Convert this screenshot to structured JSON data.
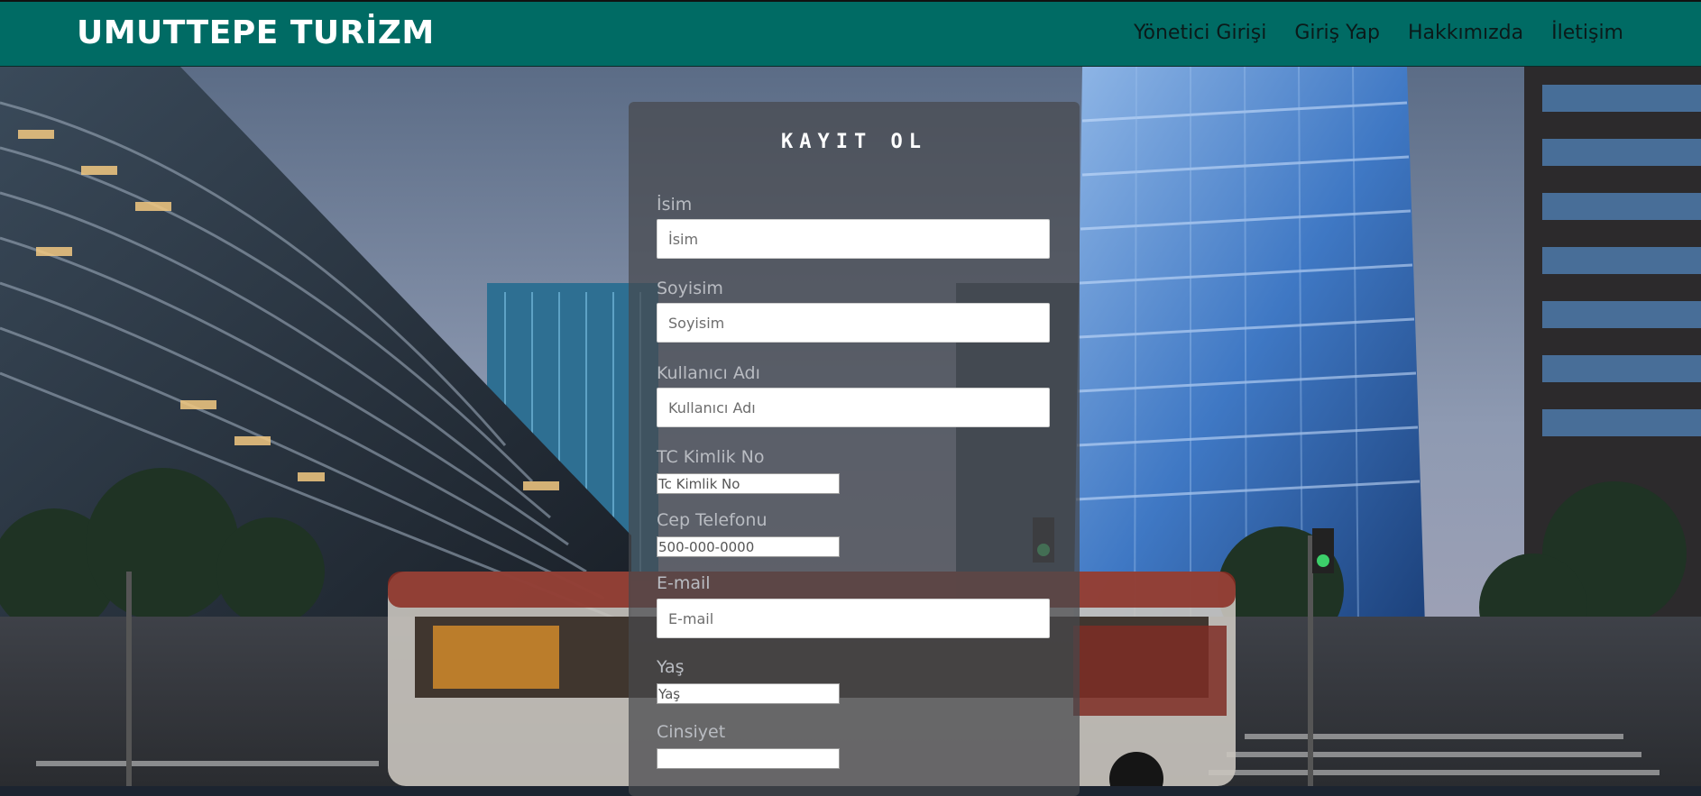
{
  "header": {
    "brand": "UMUTTEPE TURİZM",
    "nav": [
      "Yönetici Girişi",
      "Giriş Yap",
      "Hakkımızda",
      "İletişim"
    ]
  },
  "colors": {
    "header_bg": "#006b64",
    "card_bg": "rgba(70,72,76,0.72)",
    "label": "#b9bcc2"
  },
  "form": {
    "title": "KAYIT OL",
    "fields": [
      {
        "label": "İsim",
        "placeholder": "İsim"
      },
      {
        "label": "Soyisim",
        "placeholder": "Soyisim"
      },
      {
        "label": "Kullanıcı Adı",
        "placeholder": "Kullanıcı Adı"
      },
      {
        "label": "TC Kimlik No",
        "placeholder": "Tc Kimlik No"
      },
      {
        "label": "Cep Telefonu",
        "placeholder": "500-000-0000"
      },
      {
        "label": "E-mail",
        "placeholder": "E-mail"
      },
      {
        "label": "Yaş",
        "placeholder": "Yaş"
      },
      {
        "label": "Cinsiyet",
        "placeholder": ""
      }
    ]
  },
  "background": {
    "icon": "city-street-photo"
  }
}
